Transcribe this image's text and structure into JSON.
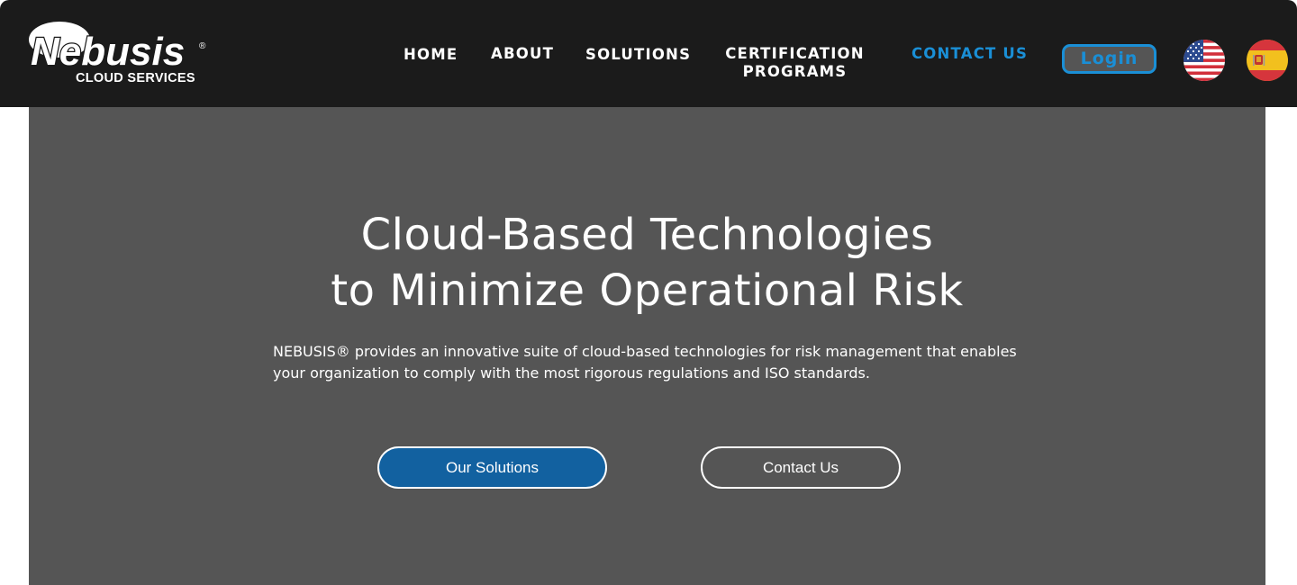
{
  "header": {
    "logo": {
      "brand": "Nebusis",
      "registered": "®",
      "subtitle": "CLOUD SERVICES"
    },
    "nav": {
      "home": "HOME",
      "about": "ABOUT",
      "solutions": "SOLUTIONS",
      "certification_line1": "CERTIFICATION",
      "certification_line2": "PROGRAMS",
      "contact": "CONTACT US"
    },
    "login_label": "Login",
    "languages": [
      "us-flag-icon",
      "spain-flag-icon"
    ]
  },
  "hero": {
    "title_line1": "Cloud-Based Technologies",
    "title_line2": "to Minimize Operational Risk",
    "description": "NEBUSIS® provides an innovative suite of cloud-based technologies for risk management that enables your organization to comply with the most rigorous regulations and ISO standards.",
    "primary_button": "Our Solutions",
    "secondary_button": "Contact Us"
  },
  "colors": {
    "header_bg": "#1b1b1b",
    "hero_bg": "#555555",
    "accent": "#1a8fd6",
    "primary_button": "#1261a0"
  }
}
